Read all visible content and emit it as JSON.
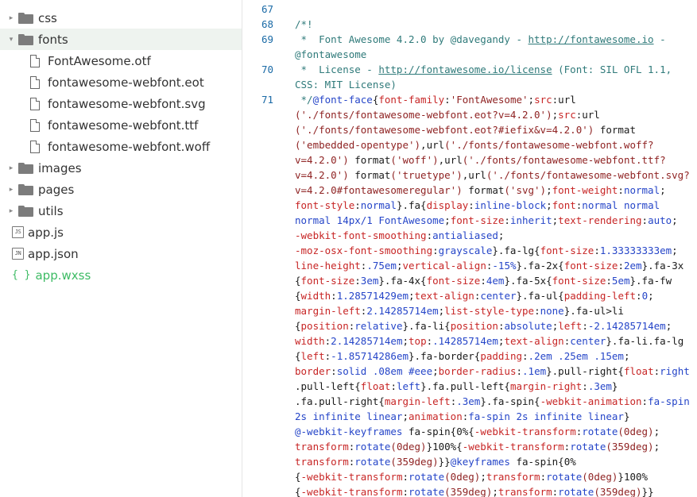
{
  "sidebar": {
    "items": [
      {
        "label": "css",
        "type": "folder",
        "expanded": false
      },
      {
        "label": "fonts",
        "type": "folder",
        "expanded": true,
        "selected": true
      },
      {
        "label": "FontAwesome.otf",
        "type": "file"
      },
      {
        "label": "fontawesome-webfont.eot",
        "type": "file"
      },
      {
        "label": "fontawesome-webfont.svg",
        "type": "file"
      },
      {
        "label": "fontawesome-webfont.ttf",
        "type": "file"
      },
      {
        "label": "fontawesome-webfont.woff",
        "type": "file"
      },
      {
        "label": "images",
        "type": "folder",
        "expanded": false
      },
      {
        "label": "pages",
        "type": "folder",
        "expanded": false
      },
      {
        "label": "utils",
        "type": "folder",
        "expanded": false
      },
      {
        "label": "app.js",
        "type": "js",
        "badge": "JS"
      },
      {
        "label": "app.json",
        "type": "json",
        "badge": "JN"
      },
      {
        "label": "app.wxss",
        "type": "wxss",
        "badge": "{ }"
      }
    ]
  },
  "editor": {
    "line_numbers": [
      "67",
      "68",
      "69",
      "70",
      "71"
    ],
    "lines": [
      [],
      [
        {
          "t": "/*!",
          "c": "c-comment"
        }
      ],
      [
        {
          "t": " *  Font Awesome 4.2.0 by @davegandy - ",
          "c": "c-comment"
        },
        {
          "t": "http://fontawesome.io",
          "c": "c-link"
        },
        {
          "t": " -",
          "c": "c-comment"
        }
      ],
      [
        {
          "t": "@fontawesome",
          "c": "c-comment"
        }
      ],
      [
        {
          "t": " *  License - ",
          "c": "c-comment"
        },
        {
          "t": "http://fontawesome.io/license",
          "c": "c-link"
        },
        {
          "t": " (Font: SIL OFL 1.1,",
          "c": "c-comment"
        }
      ],
      [
        {
          "t": "CSS: MIT License)",
          "c": "c-comment"
        }
      ],
      [
        {
          "t": " */",
          "c": "c-comment"
        },
        {
          "t": "@font-face",
          "c": "c-at"
        },
        {
          "t": "{",
          "c": "c-plain"
        },
        {
          "t": "font-family",
          "c": "c-prop"
        },
        {
          "t": ":",
          "c": "c-plain"
        },
        {
          "t": "'FontAwesome'",
          "c": "c-str"
        },
        {
          "t": ";",
          "c": "c-plain"
        },
        {
          "t": "src",
          "c": "c-prop"
        },
        {
          "t": ":url",
          "c": "c-plain"
        }
      ],
      [
        {
          "t": "('./fonts/fontawesome-webfont.eot?v=4.2.0')",
          "c": "c-str"
        },
        {
          "t": ";",
          "c": "c-plain"
        },
        {
          "t": "src",
          "c": "c-prop"
        },
        {
          "t": ":url",
          "c": "c-plain"
        }
      ],
      [
        {
          "t": "('./fonts/fontawesome-webfont.eot?#iefix&v=4.2.0')",
          "c": "c-str"
        },
        {
          "t": " format",
          "c": "c-plain"
        }
      ],
      [
        {
          "t": "('embedded-opentype')",
          "c": "c-str"
        },
        {
          "t": ",url",
          "c": "c-plain"
        },
        {
          "t": "('./fonts/fontawesome-webfont.woff?",
          "c": "c-str"
        }
      ],
      [
        {
          "t": "v=4.2.0')",
          "c": "c-str"
        },
        {
          "t": " format",
          "c": "c-plain"
        },
        {
          "t": "('woff')",
          "c": "c-str"
        },
        {
          "t": ",url",
          "c": "c-plain"
        },
        {
          "t": "('./fonts/fontawesome-webfont.ttf?",
          "c": "c-str"
        }
      ],
      [
        {
          "t": "v=4.2.0')",
          "c": "c-str"
        },
        {
          "t": " format",
          "c": "c-plain"
        },
        {
          "t": "('truetype')",
          "c": "c-str"
        },
        {
          "t": ",url",
          "c": "c-plain"
        },
        {
          "t": "('./fonts/fontawesome-webfont.svg?",
          "c": "c-str"
        }
      ],
      [
        {
          "t": "v=4.2.0#fontawesomeregular')",
          "c": "c-str"
        },
        {
          "t": " format",
          "c": "c-plain"
        },
        {
          "t": "('svg')",
          "c": "c-str"
        },
        {
          "t": ";",
          "c": "c-plain"
        },
        {
          "t": "font-weight",
          "c": "c-prop"
        },
        {
          "t": ":",
          "c": "c-plain"
        },
        {
          "t": "normal",
          "c": "c-val"
        },
        {
          "t": ";",
          "c": "c-plain"
        }
      ],
      [
        {
          "t": "font-style",
          "c": "c-prop"
        },
        {
          "t": ":",
          "c": "c-plain"
        },
        {
          "t": "normal",
          "c": "c-val"
        },
        {
          "t": "}.fa{",
          "c": "c-plain"
        },
        {
          "t": "display",
          "c": "c-prop"
        },
        {
          "t": ":",
          "c": "c-plain"
        },
        {
          "t": "inline-block",
          "c": "c-val"
        },
        {
          "t": ";",
          "c": "c-plain"
        },
        {
          "t": "font",
          "c": "c-prop"
        },
        {
          "t": ":",
          "c": "c-plain"
        },
        {
          "t": "normal normal",
          "c": "c-val"
        }
      ],
      [
        {
          "t": "normal 14px/1 FontAwesome",
          "c": "c-val"
        },
        {
          "t": ";",
          "c": "c-plain"
        },
        {
          "t": "font-size",
          "c": "c-prop"
        },
        {
          "t": ":",
          "c": "c-plain"
        },
        {
          "t": "inherit",
          "c": "c-val"
        },
        {
          "t": ";",
          "c": "c-plain"
        },
        {
          "t": "text-rendering",
          "c": "c-prop"
        },
        {
          "t": ":",
          "c": "c-plain"
        },
        {
          "t": "auto",
          "c": "c-val"
        },
        {
          "t": ";",
          "c": "c-plain"
        }
      ],
      [
        {
          "t": "-webkit-font-smoothing",
          "c": "c-prop"
        },
        {
          "t": ":",
          "c": "c-plain"
        },
        {
          "t": "antialiased",
          "c": "c-val"
        },
        {
          "t": ";",
          "c": "c-plain"
        }
      ],
      [
        {
          "t": "-moz-osx-font-smoothing",
          "c": "c-prop"
        },
        {
          "t": ":",
          "c": "c-plain"
        },
        {
          "t": "grayscale",
          "c": "c-val"
        },
        {
          "t": "}.fa-lg{",
          "c": "c-plain"
        },
        {
          "t": "font-size",
          "c": "c-prop"
        },
        {
          "t": ":",
          "c": "c-plain"
        },
        {
          "t": "1.33333333em",
          "c": "c-val"
        },
        {
          "t": ";",
          "c": "c-plain"
        }
      ],
      [
        {
          "t": "line-height",
          "c": "c-prop"
        },
        {
          "t": ":",
          "c": "c-plain"
        },
        {
          "t": ".75em",
          "c": "c-val"
        },
        {
          "t": ";",
          "c": "c-plain"
        },
        {
          "t": "vertical-align",
          "c": "c-prop"
        },
        {
          "t": ":",
          "c": "c-plain"
        },
        {
          "t": "-15%",
          "c": "c-val"
        },
        {
          "t": "}.fa-2x{",
          "c": "c-plain"
        },
        {
          "t": "font-size",
          "c": "c-prop"
        },
        {
          "t": ":",
          "c": "c-plain"
        },
        {
          "t": "2em",
          "c": "c-val"
        },
        {
          "t": "}.fa-3x",
          "c": "c-plain"
        }
      ],
      [
        {
          "t": "{",
          "c": "c-plain"
        },
        {
          "t": "font-size",
          "c": "c-prop"
        },
        {
          "t": ":",
          "c": "c-plain"
        },
        {
          "t": "3em",
          "c": "c-val"
        },
        {
          "t": "}.fa-4x{",
          "c": "c-plain"
        },
        {
          "t": "font-size",
          "c": "c-prop"
        },
        {
          "t": ":",
          "c": "c-plain"
        },
        {
          "t": "4em",
          "c": "c-val"
        },
        {
          "t": "}.fa-5x{",
          "c": "c-plain"
        },
        {
          "t": "font-size",
          "c": "c-prop"
        },
        {
          "t": ":",
          "c": "c-plain"
        },
        {
          "t": "5em",
          "c": "c-val"
        },
        {
          "t": "}.fa-fw",
          "c": "c-plain"
        }
      ],
      [
        {
          "t": "{",
          "c": "c-plain"
        },
        {
          "t": "width",
          "c": "c-prop"
        },
        {
          "t": ":",
          "c": "c-plain"
        },
        {
          "t": "1.28571429em",
          "c": "c-val"
        },
        {
          "t": ";",
          "c": "c-plain"
        },
        {
          "t": "text-align",
          "c": "c-prop"
        },
        {
          "t": ":",
          "c": "c-plain"
        },
        {
          "t": "center",
          "c": "c-val"
        },
        {
          "t": "}.fa-ul{",
          "c": "c-plain"
        },
        {
          "t": "padding-left",
          "c": "c-prop"
        },
        {
          "t": ":",
          "c": "c-plain"
        },
        {
          "t": "0",
          "c": "c-val"
        },
        {
          "t": ";",
          "c": "c-plain"
        }
      ],
      [
        {
          "t": "margin-left",
          "c": "c-prop"
        },
        {
          "t": ":",
          "c": "c-plain"
        },
        {
          "t": "2.14285714em",
          "c": "c-val"
        },
        {
          "t": ";",
          "c": "c-plain"
        },
        {
          "t": "list-style-type",
          "c": "c-prop"
        },
        {
          "t": ":",
          "c": "c-plain"
        },
        {
          "t": "none",
          "c": "c-val"
        },
        {
          "t": "}.fa-ul>li",
          "c": "c-plain"
        }
      ],
      [
        {
          "t": "{",
          "c": "c-plain"
        },
        {
          "t": "position",
          "c": "c-prop"
        },
        {
          "t": ":",
          "c": "c-plain"
        },
        {
          "t": "relative",
          "c": "c-val"
        },
        {
          "t": "}.fa-li{",
          "c": "c-plain"
        },
        {
          "t": "position",
          "c": "c-prop"
        },
        {
          "t": ":",
          "c": "c-plain"
        },
        {
          "t": "absolute",
          "c": "c-val"
        },
        {
          "t": ";",
          "c": "c-plain"
        },
        {
          "t": "left",
          "c": "c-prop"
        },
        {
          "t": ":",
          "c": "c-plain"
        },
        {
          "t": "-2.14285714em",
          "c": "c-val"
        },
        {
          "t": ";",
          "c": "c-plain"
        }
      ],
      [
        {
          "t": "width",
          "c": "c-prop"
        },
        {
          "t": ":",
          "c": "c-plain"
        },
        {
          "t": "2.14285714em",
          "c": "c-val"
        },
        {
          "t": ";",
          "c": "c-plain"
        },
        {
          "t": "top",
          "c": "c-prop"
        },
        {
          "t": ":",
          "c": "c-plain"
        },
        {
          "t": ".14285714em",
          "c": "c-val"
        },
        {
          "t": ";",
          "c": "c-plain"
        },
        {
          "t": "text-align",
          "c": "c-prop"
        },
        {
          "t": ":",
          "c": "c-plain"
        },
        {
          "t": "center",
          "c": "c-val"
        },
        {
          "t": "}.fa-li.fa-lg",
          "c": "c-plain"
        }
      ],
      [
        {
          "t": "{",
          "c": "c-plain"
        },
        {
          "t": "left",
          "c": "c-prop"
        },
        {
          "t": ":",
          "c": "c-plain"
        },
        {
          "t": "-1.85714286em",
          "c": "c-val"
        },
        {
          "t": "}.fa-border{",
          "c": "c-plain"
        },
        {
          "t": "padding",
          "c": "c-prop"
        },
        {
          "t": ":",
          "c": "c-plain"
        },
        {
          "t": ".2em .25em .15em",
          "c": "c-val"
        },
        {
          "t": ";",
          "c": "c-plain"
        }
      ],
      [
        {
          "t": "border",
          "c": "c-prop"
        },
        {
          "t": ":",
          "c": "c-plain"
        },
        {
          "t": "solid .08em #eee",
          "c": "c-val"
        },
        {
          "t": ";",
          "c": "c-plain"
        },
        {
          "t": "border-radius",
          "c": "c-prop"
        },
        {
          "t": ":",
          "c": "c-plain"
        },
        {
          "t": ".1em",
          "c": "c-val"
        },
        {
          "t": "}.pull-right{",
          "c": "c-plain"
        },
        {
          "t": "float",
          "c": "c-prop"
        },
        {
          "t": ":",
          "c": "c-plain"
        },
        {
          "t": "right",
          "c": "c-val"
        }
      ],
      [
        {
          "t": ".pull-left{",
          "c": "c-plain"
        },
        {
          "t": "float",
          "c": "c-prop"
        },
        {
          "t": ":",
          "c": "c-plain"
        },
        {
          "t": "left",
          "c": "c-val"
        },
        {
          "t": "}.fa.pull-left{",
          "c": "c-plain"
        },
        {
          "t": "margin-right",
          "c": "c-prop"
        },
        {
          "t": ":",
          "c": "c-plain"
        },
        {
          "t": ".3em",
          "c": "c-val"
        },
        {
          "t": "}",
          "c": "c-plain"
        }
      ],
      [
        {
          "t": ".fa.pull-right{",
          "c": "c-plain"
        },
        {
          "t": "margin-left",
          "c": "c-prop"
        },
        {
          "t": ":",
          "c": "c-plain"
        },
        {
          "t": ".3em",
          "c": "c-val"
        },
        {
          "t": "}.fa-spin{",
          "c": "c-plain"
        },
        {
          "t": "-webkit-animation",
          "c": "c-prop"
        },
        {
          "t": ":",
          "c": "c-plain"
        },
        {
          "t": "fa-spin",
          "c": "c-val"
        }
      ],
      [
        {
          "t": "2s infinite linear",
          "c": "c-val"
        },
        {
          "t": ";",
          "c": "c-plain"
        },
        {
          "t": "animation",
          "c": "c-prop"
        },
        {
          "t": ":",
          "c": "c-plain"
        },
        {
          "t": "fa-spin 2s infinite linear",
          "c": "c-val"
        },
        {
          "t": "}",
          "c": "c-plain"
        }
      ],
      [
        {
          "t": "@-webkit-keyframes",
          "c": "c-at"
        },
        {
          "t": " fa-spin{0%{",
          "c": "c-plain"
        },
        {
          "t": "-webkit-transform",
          "c": "c-prop"
        },
        {
          "t": ":",
          "c": "c-plain"
        },
        {
          "t": "rotate",
          "c": "c-val"
        },
        {
          "t": "(0deg)",
          "c": "c-str"
        },
        {
          "t": ";",
          "c": "c-plain"
        }
      ],
      [
        {
          "t": "transform",
          "c": "c-prop"
        },
        {
          "t": ":",
          "c": "c-plain"
        },
        {
          "t": "rotate",
          "c": "c-val"
        },
        {
          "t": "(0deg)",
          "c": "c-str"
        },
        {
          "t": "}100%{",
          "c": "c-plain"
        },
        {
          "t": "-webkit-transform",
          "c": "c-prop"
        },
        {
          "t": ":",
          "c": "c-plain"
        },
        {
          "t": "rotate",
          "c": "c-val"
        },
        {
          "t": "(359deg)",
          "c": "c-str"
        },
        {
          "t": ";",
          "c": "c-plain"
        }
      ],
      [
        {
          "t": "transform",
          "c": "c-prop"
        },
        {
          "t": ":",
          "c": "c-plain"
        },
        {
          "t": "rotate",
          "c": "c-val"
        },
        {
          "t": "(359deg)",
          "c": "c-str"
        },
        {
          "t": "}}",
          "c": "c-plain"
        },
        {
          "t": "@keyframes",
          "c": "c-at"
        },
        {
          "t": " fa-spin{0%",
          "c": "c-plain"
        }
      ],
      [
        {
          "t": "{",
          "c": "c-plain"
        },
        {
          "t": "-webkit-transform",
          "c": "c-prop"
        },
        {
          "t": ":",
          "c": "c-plain"
        },
        {
          "t": "rotate",
          "c": "c-val"
        },
        {
          "t": "(0deg)",
          "c": "c-str"
        },
        {
          "t": ";",
          "c": "c-plain"
        },
        {
          "t": "transform",
          "c": "c-prop"
        },
        {
          "t": ":",
          "c": "c-plain"
        },
        {
          "t": "rotate",
          "c": "c-val"
        },
        {
          "t": "(0deg)",
          "c": "c-str"
        },
        {
          "t": "}100%",
          "c": "c-plain"
        }
      ],
      [
        {
          "t": "{",
          "c": "c-plain"
        },
        {
          "t": "-webkit-transform",
          "c": "c-prop"
        },
        {
          "t": ":",
          "c": "c-plain"
        },
        {
          "t": "rotate",
          "c": "c-val"
        },
        {
          "t": "(359deg)",
          "c": "c-str"
        },
        {
          "t": ";",
          "c": "c-plain"
        },
        {
          "t": "transform",
          "c": "c-prop"
        },
        {
          "t": ":",
          "c": "c-plain"
        },
        {
          "t": "rotate",
          "c": "c-val"
        },
        {
          "t": "(359deg)",
          "c": "c-str"
        },
        {
          "t": "}}",
          "c": "c-plain"
        }
      ]
    ]
  },
  "colors": {
    "selected_row": "#eef3ef",
    "wxss_green": "#3dbb64",
    "line_number": "#1a6aa6",
    "comment": "#2f7a7a",
    "property": "#c72525",
    "value": "#2545c8"
  }
}
